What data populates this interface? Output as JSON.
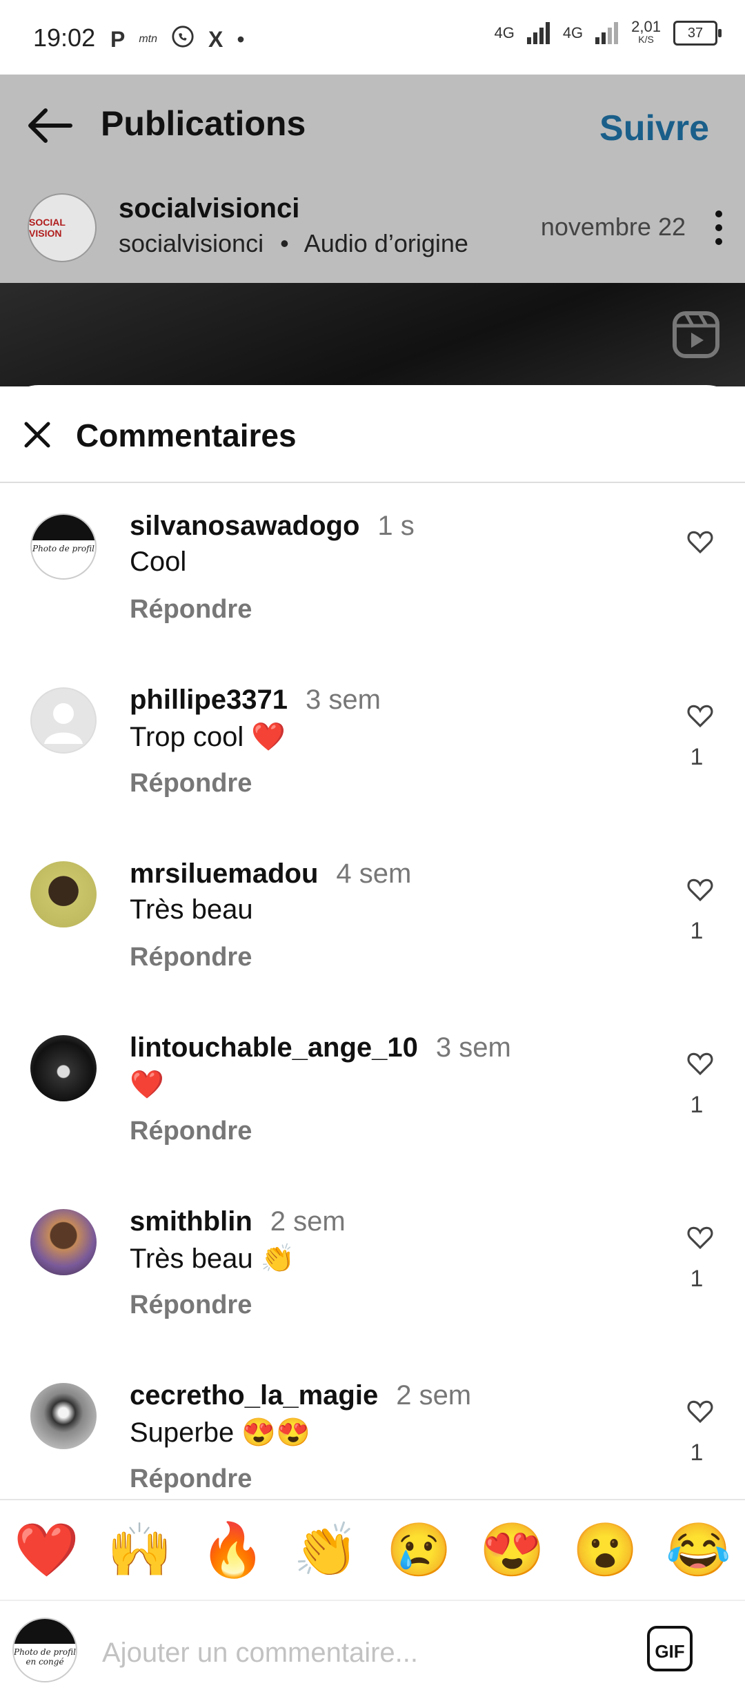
{
  "status_bar": {
    "time": "19:02",
    "notif_icons": [
      "P",
      "mtn",
      "whatsapp-icon",
      "X",
      "•"
    ],
    "net1": "4G",
    "net2": "4G",
    "speed": "2,01",
    "speed_unit": "K/S",
    "battery": "37"
  },
  "header": {
    "title": "Publications",
    "follow_label": "Suivre"
  },
  "post": {
    "author": "socialvisionci",
    "subtitle_user": "socialvisionci",
    "subtitle_audio": "Audio d’origine",
    "date": "novembre 22",
    "avatar_text": "SOCIAL VISION"
  },
  "sheet": {
    "title": "Commentaires"
  },
  "comments": [
    {
      "user": "silvanosawadogo",
      "time": "1 s",
      "text": "Cool",
      "reply": "Répondre",
      "likes": ""
    },
    {
      "user": "phillipe3371",
      "time": "3 sem",
      "text": "Trop cool ❤️",
      "reply": "Répondre",
      "likes": "1"
    },
    {
      "user": "mrsiluemadou",
      "time": "4 sem",
      "text": "Très beau",
      "reply": "Répondre",
      "likes": "1"
    },
    {
      "user": "lintouchable_ange_10",
      "time": "3 sem",
      "text": "❤️",
      "reply": "Répondre",
      "likes": "1"
    },
    {
      "user": "smithblin",
      "time": "2 sem",
      "text": "Très beau 👏",
      "reply": "Répondre",
      "likes": "1"
    },
    {
      "user": "cecretho_la_magie",
      "time": "2 sem",
      "text": "Superbe 😍😍",
      "reply": "Répondre",
      "likes": "1"
    }
  ],
  "reactions": [
    "❤️",
    "🙌",
    "🔥",
    "👏",
    "😢",
    "😍",
    "😮",
    "😂"
  ],
  "composer": {
    "placeholder": "Ajouter un commentaire...",
    "gif_label": "GIF",
    "avatar_text": "Photo de profil en congé"
  },
  "colors": {
    "follow": "#1a5f8a",
    "overlay": "#bdbdbd",
    "muted": "#777777"
  }
}
